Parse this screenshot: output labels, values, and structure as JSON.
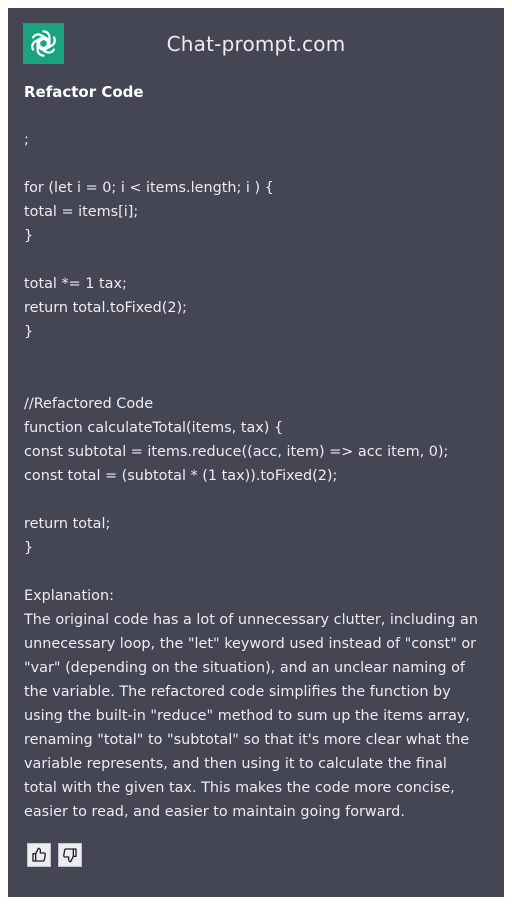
{
  "header": {
    "site_title": "Chat-prompt.com",
    "logo_icon": "openai-logo-icon",
    "logo_color": "#19a37f"
  },
  "prompt": {
    "title": "Refactor Code"
  },
  "content": {
    "lines": [
      ";",
      "",
      "for (let i = 0; i < items.length; i ) {",
      "total = items[i];",
      "}",
      "",
      "total *= 1 tax;",
      "return total.toFixed(2);",
      "}",
      "",
      "",
      "//Refactored Code",
      "function calculateTotal(items, tax) {",
      "const subtotal = items.reduce((acc, item) => acc item, 0);",
      "const total = (subtotal * (1 tax)).toFixed(2);",
      "",
      "return total;",
      "}",
      "",
      "Explanation:"
    ],
    "explanation": "The original code has a lot of unnecessary clutter, including an unnecessary loop, the \"let\" keyword used instead of \"const\" or \"var\" (depending on the situation), and an unclear naming of the variable. The refactored code simplifies the function by using the built-in \"reduce\" method to sum up the items array, renaming \"total\" to \"subtotal\" so that it's more clear what the variable represents, and then using it to calculate the final total with the given tax. This makes the code more concise, easier to read, and easier to maintain going forward."
  },
  "feedback": {
    "thumbs_up_icon": "thumbs-up-icon",
    "thumbs_down_icon": "thumbs-down-icon"
  },
  "colors": {
    "background": "#444654",
    "text": "#ececf1",
    "page": "#ffffff"
  }
}
